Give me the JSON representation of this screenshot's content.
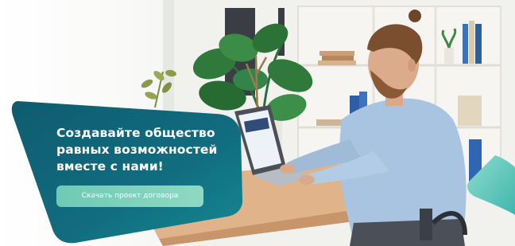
{
  "banner": {
    "headline_lines": [
      "Создавайте общество",
      "равных возможностей",
      "вместе с нами!"
    ],
    "cta_label": "Скачать проект договора"
  },
  "colors": {
    "card_teal_dark": "#0e5c6e",
    "card_teal_light": "#14808f",
    "cta_mint": "#7fd2bd",
    "accent_corner": "#5cc7b8"
  },
  "icons": [
    "monstera-plant-photo",
    "man-with-laptop-photo",
    "bookshelf-photo"
  ]
}
